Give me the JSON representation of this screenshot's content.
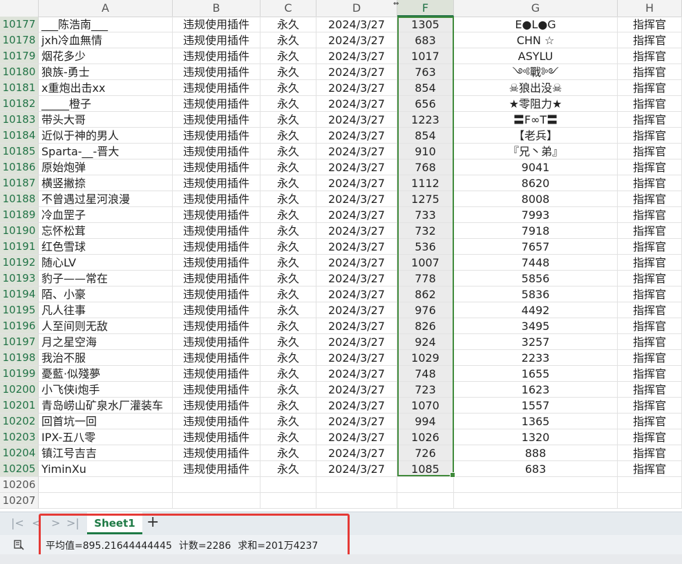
{
  "columns": [
    "A",
    "B",
    "C",
    "D",
    "F",
    "G",
    "H"
  ],
  "selected_column": "F",
  "rows": [
    {
      "n": "10177",
      "a": "___陈浩南___",
      "b": "违规使用插件",
      "c": "永久",
      "d": "2024/3/27",
      "f": "1305",
      "g": "E●L●G",
      "h": "指挥官"
    },
    {
      "n": "10178",
      "a": "jxh冷血無情",
      "b": "违规使用插件",
      "c": "永久",
      "d": "2024/3/27",
      "f": "683",
      "g": "CHN ☆",
      "h": "指挥官"
    },
    {
      "n": "10179",
      "a": "烟花多少",
      "b": "违规使用插件",
      "c": "永久",
      "d": "2024/3/27",
      "f": "1017",
      "g": "ASYLU",
      "h": "指挥官"
    },
    {
      "n": "10180",
      "a": "狼族-勇士",
      "b": "违规使用插件",
      "c": "永久",
      "d": "2024/3/27",
      "f": "763",
      "g": "༺戰༻",
      "h": "指挥官"
    },
    {
      "n": "10181",
      "a": "x重炮出击xx",
      "b": "违规使用插件",
      "c": "永久",
      "d": "2024/3/27",
      "f": "854",
      "g": "☠狼出没☠",
      "h": "指挥官"
    },
    {
      "n": "10182",
      "a": "_____橙子",
      "b": "违规使用插件",
      "c": "永久",
      "d": "2024/3/27",
      "f": "656",
      "g": "★零阻力★",
      "h": "指挥官"
    },
    {
      "n": "10183",
      "a": "带头大哥",
      "b": "违规使用插件",
      "c": "永久",
      "d": "2024/3/27",
      "f": "1223",
      "g": "〓F∞T〓",
      "h": "指挥官"
    },
    {
      "n": "10184",
      "a": "近似于神的男人",
      "b": "违规使用插件",
      "c": "永久",
      "d": "2024/3/27",
      "f": "854",
      "g": "【老兵】",
      "h": "指挥官"
    },
    {
      "n": "10185",
      "a": "Sparta-__-晋大",
      "b": "违规使用插件",
      "c": "永久",
      "d": "2024/3/27",
      "f": "910",
      "g": "『兄丶弟』",
      "h": "指挥官"
    },
    {
      "n": "10186",
      "a": "原始炮弹",
      "b": "违规使用插件",
      "c": "永久",
      "d": "2024/3/27",
      "f": "768",
      "g": "9041",
      "h": "指挥官"
    },
    {
      "n": "10187",
      "a": "横竖撇捺",
      "b": "违规使用插件",
      "c": "永久",
      "d": "2024/3/27",
      "f": "1112",
      "g": "8620",
      "h": "指挥官"
    },
    {
      "n": "10188",
      "a": "不曾遇过星河浪漫",
      "b": "违规使用插件",
      "c": "永久",
      "d": "2024/3/27",
      "f": "1275",
      "g": "8008",
      "h": "指挥官"
    },
    {
      "n": "10189",
      "a": "冷血罡子",
      "b": "违规使用插件",
      "c": "永久",
      "d": "2024/3/27",
      "f": "733",
      "g": "7993",
      "h": "指挥官"
    },
    {
      "n": "10190",
      "a": "忘怀松茸",
      "b": "违规使用插件",
      "c": "永久",
      "d": "2024/3/27",
      "f": "732",
      "g": "7918",
      "h": "指挥官"
    },
    {
      "n": "10191",
      "a": "红色雪球",
      "b": "违规使用插件",
      "c": "永久",
      "d": "2024/3/27",
      "f": "536",
      "g": "7657",
      "h": "指挥官"
    },
    {
      "n": "10192",
      "a": "随心LV",
      "b": "违规使用插件",
      "c": "永久",
      "d": "2024/3/27",
      "f": "1007",
      "g": "7448",
      "h": "指挥官"
    },
    {
      "n": "10193",
      "a": "豹子——常在",
      "b": "违规使用插件",
      "c": "永久",
      "d": "2024/3/27",
      "f": "778",
      "g": "5856",
      "h": "指挥官"
    },
    {
      "n": "10194",
      "a": "陌、小豪",
      "b": "违规使用插件",
      "c": "永久",
      "d": "2024/3/27",
      "f": "862",
      "g": "5836",
      "h": "指挥官"
    },
    {
      "n": "10195",
      "a": "凡人往事",
      "b": "违规使用插件",
      "c": "永久",
      "d": "2024/3/27",
      "f": "976",
      "g": "4492",
      "h": "指挥官"
    },
    {
      "n": "10196",
      "a": "人至间则无敌",
      "b": "违规使用插件",
      "c": "永久",
      "d": "2024/3/27",
      "f": "826",
      "g": "3495",
      "h": "指挥官"
    },
    {
      "n": "10197",
      "a": "月之星空海",
      "b": "违规使用插件",
      "c": "永久",
      "d": "2024/3/27",
      "f": "924",
      "g": "3257",
      "h": "指挥官"
    },
    {
      "n": "10198",
      "a": "我治不服",
      "b": "违规使用插件",
      "c": "永久",
      "d": "2024/3/27",
      "f": "1029",
      "g": "2233",
      "h": "指挥官"
    },
    {
      "n": "10199",
      "a": "憂藍·似殘夢",
      "b": "违规使用插件",
      "c": "永久",
      "d": "2024/3/27",
      "f": "748",
      "g": "1655",
      "h": "指挥官"
    },
    {
      "n": "10200",
      "a": "小飞侠i炮手",
      "b": "违规使用插件",
      "c": "永久",
      "d": "2024/3/27",
      "f": "723",
      "g": "1623",
      "h": "指挥官"
    },
    {
      "n": "10201",
      "a": "青岛崂山矿泉水厂灌装车",
      "b": "违规使用插件",
      "c": "永久",
      "d": "2024/3/27",
      "f": "1070",
      "g": "1557",
      "h": "指挥官"
    },
    {
      "n": "10202",
      "a": "回首坑一回",
      "b": "违规使用插件",
      "c": "永久",
      "d": "2024/3/27",
      "f": "994",
      "g": "1365",
      "h": "指挥官"
    },
    {
      "n": "10203",
      "a": "IPX-五八零",
      "b": "违规使用插件",
      "c": "永久",
      "d": "2024/3/27",
      "f": "1026",
      "g": "1320",
      "h": "指挥官"
    },
    {
      "n": "10204",
      "a": "镇江号吉吉",
      "b": "违规使用插件",
      "c": "永久",
      "d": "2024/3/27",
      "f": "726",
      "g": "888",
      "h": "指挥官"
    },
    {
      "n": "10205",
      "a": "YiminXu",
      "b": "违规使用插件",
      "c": "永久",
      "d": "2024/3/27",
      "f": "1085",
      "g": "683",
      "h": "指挥官"
    },
    {
      "n": "10206",
      "a": "",
      "b": "",
      "c": "",
      "d": "",
      "f": "",
      "g": "",
      "h": ""
    },
    {
      "n": "10207",
      "a": "",
      "b": "",
      "c": "",
      "d": "",
      "f": "",
      "g": "",
      "h": ""
    }
  ],
  "sheet_tab": "Sheet1",
  "add_tab": "+",
  "status": {
    "average": "平均值=895.21644444445",
    "count": "计数=2286",
    "sum": "求和=201万4237"
  },
  "colors": {
    "accent": "#217346",
    "highlight": "#e53935"
  }
}
